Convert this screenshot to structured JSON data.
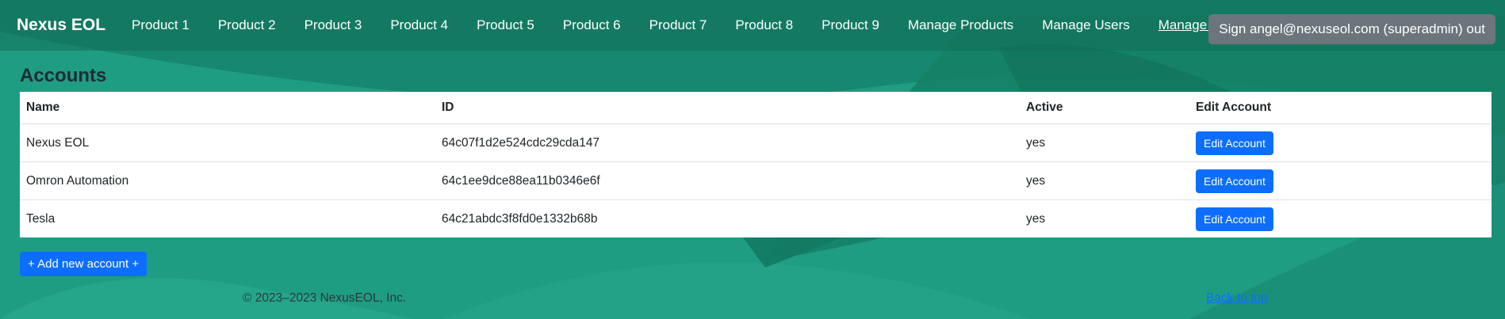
{
  "nav": {
    "brand": "Nexus EOL",
    "links": [
      {
        "label": "Product 1"
      },
      {
        "label": "Product 2"
      },
      {
        "label": "Product 3"
      },
      {
        "label": "Product 4"
      },
      {
        "label": "Product 5"
      },
      {
        "label": "Product 6"
      },
      {
        "label": "Product 7"
      },
      {
        "label": "Product 8"
      },
      {
        "label": "Product 9"
      },
      {
        "label": "Manage Products"
      },
      {
        "label": "Manage Users"
      },
      {
        "label": "Manage Accounts"
      }
    ],
    "signout": "Sign angel@nexuseol.com (superadmin) out"
  },
  "main": {
    "title": "Accounts",
    "table": {
      "headers": [
        "Name",
        "ID",
        "Active",
        "Edit Account"
      ],
      "rows": [
        {
          "name": "Nexus EOL",
          "id": "64c07f1d2e524cdc29cda147",
          "active": "yes",
          "edit_label": "Edit Account"
        },
        {
          "name": "Omron Automation",
          "id": "64c1ee9dce88ea11b0346e6f",
          "active": "yes",
          "edit_label": "Edit Account"
        },
        {
          "name": "Tesla",
          "id": "64c21abdc3f8fd0e1332b68b",
          "active": "yes",
          "edit_label": "Edit Account"
        }
      ]
    },
    "add_button": "+ Add new account +"
  },
  "footer": {
    "copyright": "© 2023–2023 NexusEOL, Inc.",
    "back_to_top": "Back to top"
  },
  "colors": {
    "background": "#1e9b82",
    "primary": "#0d6efd",
    "secondary": "#6c757d"
  }
}
